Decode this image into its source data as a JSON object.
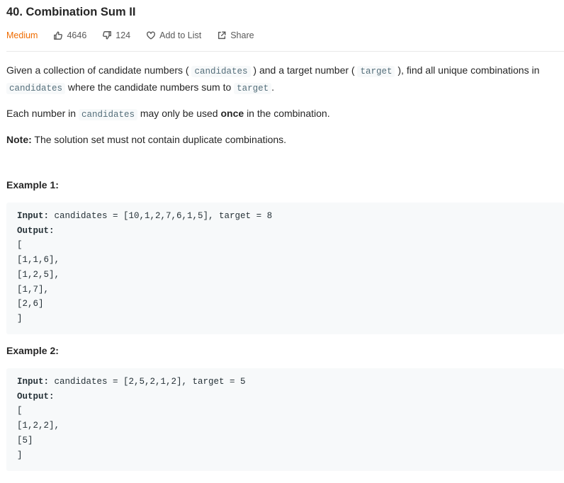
{
  "problem": {
    "title": "40. Combination Sum II",
    "difficulty": "Medium",
    "likes": "4646",
    "dislikes": "124",
    "add_to_list": "Add to List",
    "share": "Share"
  },
  "description": {
    "p1_part1": "Given a collection of candidate numbers (",
    "p1_code1": "candidates",
    "p1_part2": ") and a target number (",
    "p1_code2": "target",
    "p1_part3": "), find all unique combinations in",
    "p1_code3": "candidates",
    "p1_part4": "where the candidate numbers sum to",
    "p1_code4": "target",
    "p1_part5": ".",
    "p2_part1": "Each number in",
    "p2_code1": "candidates",
    "p2_part2": "may only be used",
    "p2_bold": "once",
    "p2_part3": "in the combination.",
    "note_label": "Note:",
    "note_text": "The solution set must not contain duplicate combinations."
  },
  "examples": [
    {
      "heading": "Example 1:",
      "input_label": "Input:",
      "input_text": " candidates = [10,1,2,7,6,1,5], target = 8",
      "output_label": "Output:",
      "output_lines": [
        "[",
        "[1,1,6],",
        "[1,2,5],",
        "[1,7],",
        "[2,6]",
        "]"
      ]
    },
    {
      "heading": "Example 2:",
      "input_label": "Input:",
      "input_text": " candidates = [2,5,2,1,2], target = 5",
      "output_label": "Output:",
      "output_lines": [
        "[",
        "[1,2,2],",
        "[5]",
        "]"
      ]
    }
  ],
  "colors": {
    "difficulty_medium": "#ef6c00",
    "code_bg": "#f7f9fa",
    "code_text": "#546e7a"
  },
  "icons": {
    "likes": "thumbs-up-icon",
    "dislikes": "thumbs-down-icon",
    "add_to_list": "heart-icon",
    "share": "share-icon"
  }
}
